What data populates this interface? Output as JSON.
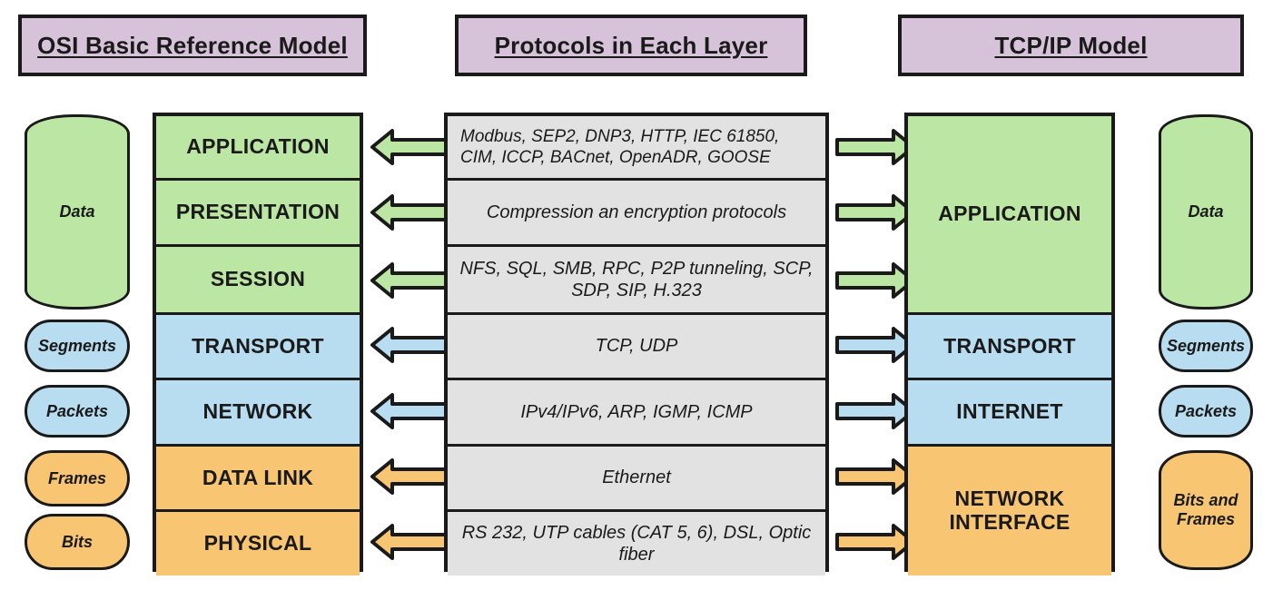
{
  "diagram": {
    "title_headers": [
      {
        "id": "osi",
        "label": "OSI Basic Reference Model"
      },
      {
        "id": "proto",
        "label": "Protocols in Each Layer"
      },
      {
        "id": "tcpip",
        "label": "TCP/IP Model"
      }
    ],
    "colors": {
      "green": "#bce6a4",
      "blue": "#b8dcf0",
      "orange": "#f8c573",
      "purple": "#d6c2d9",
      "grey": "#e2e2e2",
      "outline": "#1a1a1a",
      "background": "#ffffff"
    },
    "osi_layers": [
      {
        "name": "APPLICATION",
        "group": "green",
        "data_unit": "Data"
      },
      {
        "name": "PRESENTATION",
        "group": "green",
        "data_unit": "Data"
      },
      {
        "name": "SESSION",
        "group": "green",
        "data_unit": "Data"
      },
      {
        "name": "TRANSPORT",
        "group": "blue",
        "data_unit": "Segments"
      },
      {
        "name": "NETWORK",
        "group": "blue",
        "data_unit": "Packets"
      },
      {
        "name": "DATA LINK",
        "group": "orange",
        "data_unit": "Frames"
      },
      {
        "name": "PHYSICAL",
        "group": "orange",
        "data_unit": "Bits"
      }
    ],
    "osi_data_units": [
      {
        "label": "Data",
        "group": "green",
        "shape": "barrel"
      },
      {
        "label": "Segments",
        "group": "blue",
        "shape": "stadium"
      },
      {
        "label": "Packets",
        "group": "blue",
        "shape": "stadium"
      },
      {
        "label": "Frames",
        "group": "orange",
        "shape": "stadium"
      },
      {
        "label": "Bits",
        "group": "orange",
        "shape": "stadium"
      }
    ],
    "protocols": [
      {
        "layer": "APPLICATION",
        "text": "Modbus, SEP2, DNP3, HTTP, IEC 61850, CIM, ICCP, BACnet, OpenADR, GOOSE"
      },
      {
        "layer": "PRESENTATION",
        "text": "Compression an encryption protocols"
      },
      {
        "layer": "SESSION",
        "text": "NFS, SQL, SMB, RPC, P2P tunneling, SCP, SDP, SIP, H.323"
      },
      {
        "layer": "TRANSPORT",
        "text": "TCP, UDP"
      },
      {
        "layer": "NETWORK",
        "text": "IPv4/IPv6, ARP, IGMP, ICMP"
      },
      {
        "layer": "DATA LINK",
        "text": "Ethernet"
      },
      {
        "layer": "PHYSICAL",
        "text": "RS 232, UTP cables (CAT 5, 6), DSL, Optic fiber"
      }
    ],
    "tcpip_layers": [
      {
        "name": "APPLICATION",
        "group": "green",
        "maps_to": [
          "APPLICATION",
          "PRESENTATION",
          "SESSION"
        ],
        "data_unit": "Data"
      },
      {
        "name": "TRANSPORT",
        "group": "blue",
        "maps_to": [
          "TRANSPORT"
        ],
        "data_unit": "Segments"
      },
      {
        "name": "INTERNET",
        "group": "blue",
        "maps_to": [
          "NETWORK"
        ],
        "data_unit": "Packets"
      },
      {
        "name": "NETWORK INTERFACE",
        "group": "orange",
        "maps_to": [
          "DATA LINK",
          "PHYSICAL"
        ],
        "data_unit": "Bits and Frames"
      }
    ],
    "tcpip_data_units": [
      {
        "label": "Data",
        "group": "green",
        "shape": "barrel"
      },
      {
        "label": "Segments",
        "group": "blue",
        "shape": "stadium"
      },
      {
        "label": "Packets",
        "group": "blue",
        "shape": "stadium"
      },
      {
        "label": "Bits and Frames",
        "group": "orange",
        "shape": "softbox"
      }
    ],
    "arrows_left": [
      {
        "direction": "left",
        "group": "green"
      },
      {
        "direction": "left",
        "group": "green"
      },
      {
        "direction": "left",
        "group": "green"
      },
      {
        "direction": "left",
        "group": "blue"
      },
      {
        "direction": "left",
        "group": "blue"
      },
      {
        "direction": "left",
        "group": "orange"
      },
      {
        "direction": "left",
        "group": "orange"
      }
    ],
    "arrows_right": [
      {
        "direction": "right",
        "group": "green"
      },
      {
        "direction": "right",
        "group": "green"
      },
      {
        "direction": "right",
        "group": "green"
      },
      {
        "direction": "right",
        "group": "blue"
      },
      {
        "direction": "right",
        "group": "blue"
      },
      {
        "direction": "right",
        "group": "orange"
      },
      {
        "direction": "right",
        "group": "orange"
      }
    ]
  }
}
